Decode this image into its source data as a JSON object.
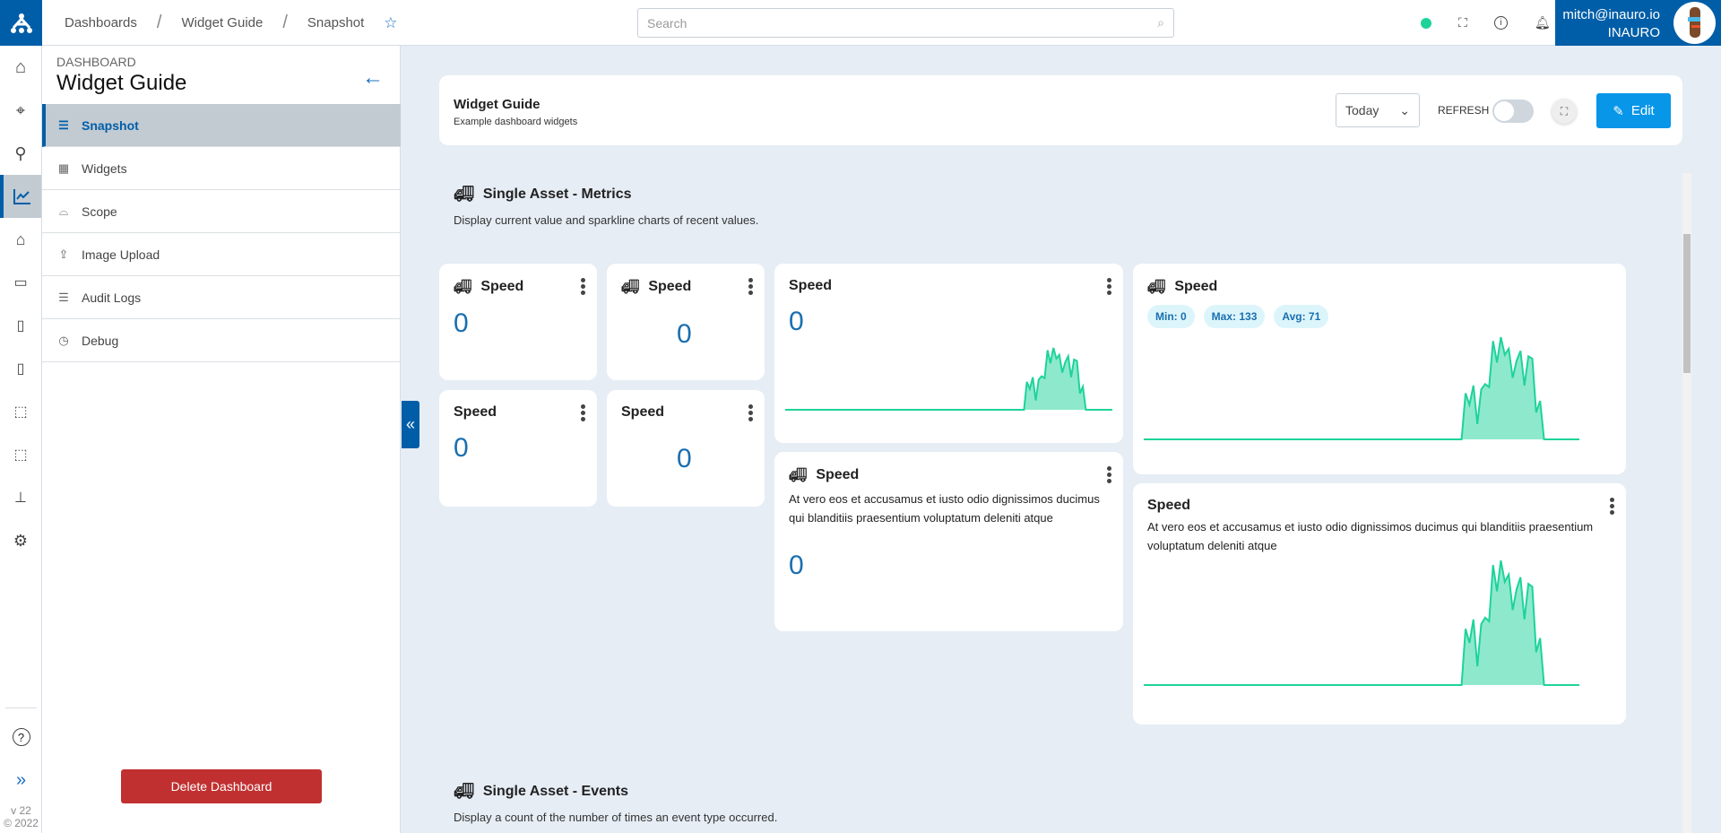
{
  "topbar": {
    "breadcrumbs": [
      "Dashboards",
      "Widget Guide",
      "Snapshot"
    ],
    "search_placeholder": "Search",
    "status_color": "#1ed39a",
    "user_email": "mitch@inauro.io",
    "user_org": "INAURO"
  },
  "rail": {
    "items": [
      "home-icon",
      "map-pin-icon",
      "location-search-icon",
      "chart-line-icon",
      "warehouse-icon",
      "folder-settings-icon",
      "report-icon",
      "document-search-icon",
      "network-icon",
      "nodes-icon",
      "hierarchy-icon",
      "gear-icon"
    ],
    "active": 3,
    "help": "help-icon",
    "expand": "double-chevron-right-icon",
    "version": "v 22",
    "copyright": "© 2022"
  },
  "sidebar": {
    "label": "DASHBOARD",
    "title": "Widget Guide",
    "items": [
      {
        "label": "Snapshot",
        "icon": "☰"
      },
      {
        "label": "Widgets",
        "icon": "▦"
      },
      {
        "label": "Scope",
        "icon": "⌓"
      },
      {
        "label": "Image Upload",
        "icon": "⇪"
      },
      {
        "label": "Audit Logs",
        "icon": "☰"
      },
      {
        "label": "Debug",
        "icon": "◷"
      }
    ],
    "active": 0,
    "delete_label": "Delete Dashboard"
  },
  "header": {
    "title": "Widget Guide",
    "subtitle": "Example dashboard widgets",
    "range": "Today",
    "refresh_label": "REFRESH",
    "refresh_on": false,
    "edit_label": "Edit",
    "accent": "#0796e8"
  },
  "sections": [
    {
      "title": "Single Asset - Metrics",
      "description": "Display current value and sparkline charts of recent values."
    },
    {
      "title": "Single Asset - Events",
      "description": "Display a count of the number of times an event type occurred."
    }
  ],
  "widgets": {
    "title": "Speed",
    "value": "0",
    "text": "At vero eos et accusamus et iusto odio dignissimos ducimus qui blanditiis praesentium voluptatum deleniti atque",
    "min": "Min: 0",
    "max": "Max: 133",
    "avg": "Avg: 71"
  },
  "sparkline": {
    "color": "#1ed39a",
    "values": [
      0,
      0,
      0,
      0,
      0,
      0,
      0,
      0,
      0,
      0,
      0,
      0,
      0,
      0,
      0,
      0,
      0,
      0,
      0,
      0,
      0,
      0,
      0,
      0,
      0,
      0,
      0,
      0,
      0,
      0,
      0,
      0,
      0,
      0,
      0,
      0,
      0,
      0,
      0,
      0,
      0,
      0,
      0,
      0,
      0,
      0,
      0,
      0,
      0,
      0,
      0,
      0,
      0,
      0,
      0,
      0,
      0,
      0,
      0,
      0,
      0,
      0,
      0,
      0,
      0,
      0,
      0,
      0,
      0,
      0,
      0,
      0,
      0,
      0,
      0,
      0,
      0,
      0,
      0,
      0,
      0,
      0,
      60,
      45,
      70,
      20,
      65,
      72,
      68,
      128,
      100,
      133,
      110,
      118,
      80,
      102,
      115,
      70,
      108,
      105,
      35,
      50,
      0,
      0,
      0,
      0,
      0,
      0,
      0,
      0,
      0,
      0
    ]
  }
}
